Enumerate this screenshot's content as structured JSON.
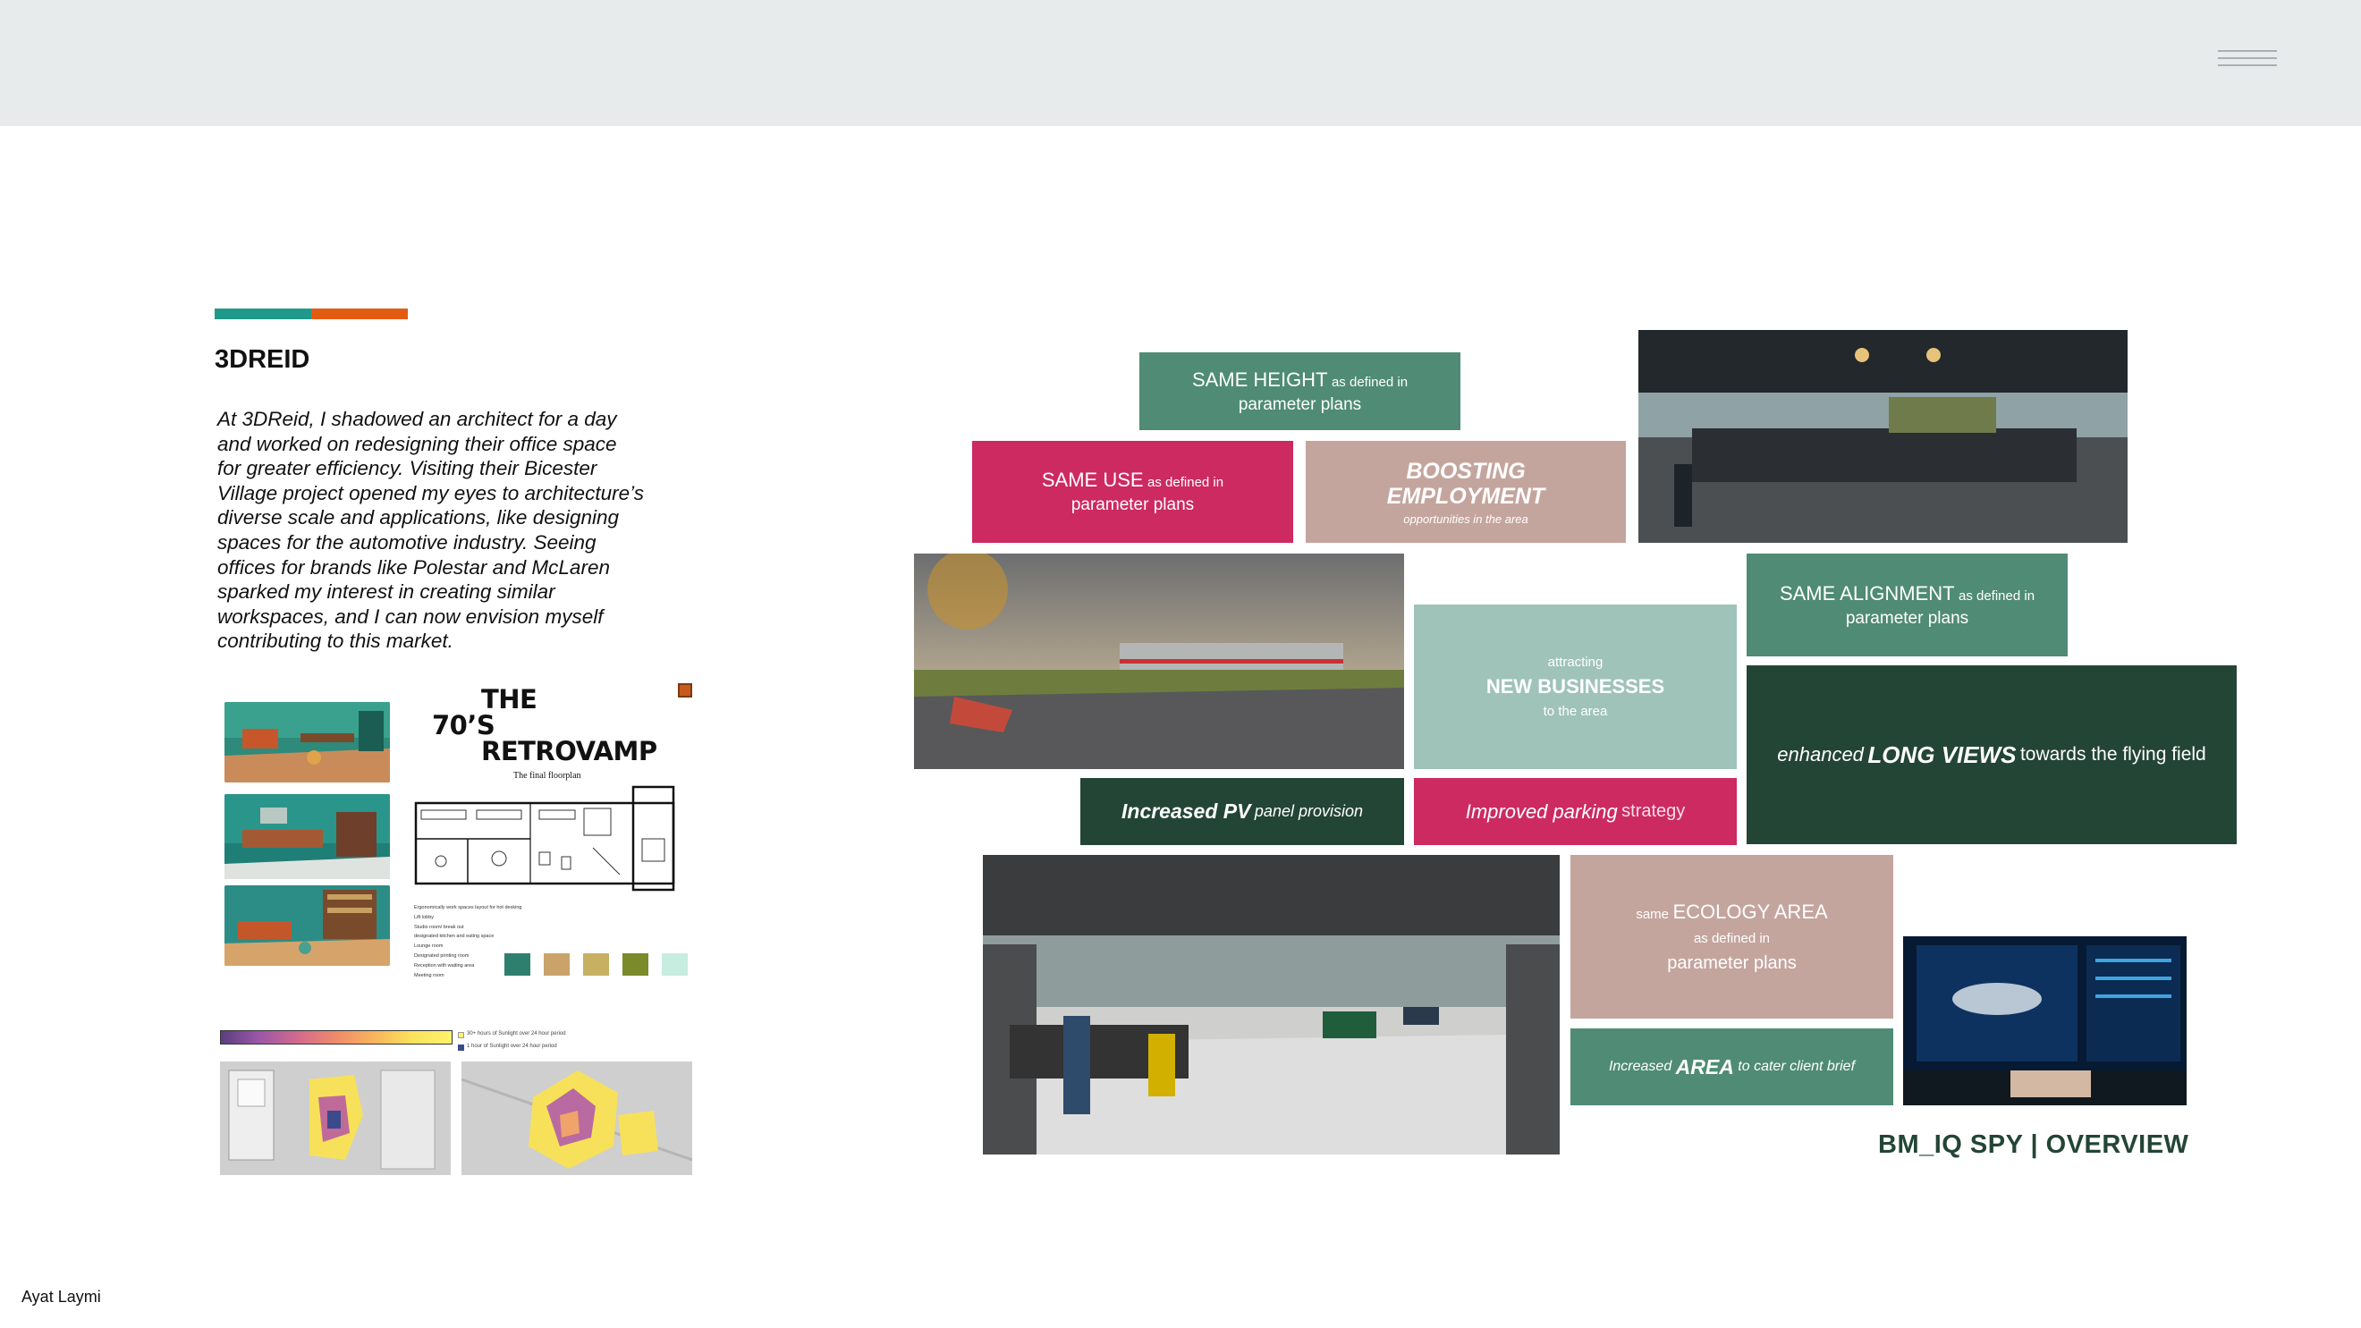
{
  "header": {
    "menu_icon": "hamburger-menu-icon"
  },
  "left": {
    "accent_colors": [
      "#1f9a8a",
      "#e35b12"
    ],
    "title": "3DREID",
    "paragraph_lines": [
      "At 3DReid, I shadowed an architect for a day",
      "and worked on redesigning their office space",
      "for greater efficiency. Visiting their Bicester",
      "Village project opened my eyes to architecture’s",
      "diverse scale and applications, like designing",
      "spaces for the automotive industry. Seeing",
      "offices for brands like Polestar and McLaren",
      "sparked my interest in creating similar",
      "workspaces, and I can now envision myself",
      "contributing to this market."
    ],
    "retrovamp": {
      "title_line1": "THE",
      "title_line2": "70’S",
      "title_line3": "RETROVAMP",
      "subtitle": "The final floorplan",
      "notes": [
        "Ergonomically work spaces layout for hot desking",
        "Lift lobby",
        "Studio room/ break out",
        "designated kitchen and eating space",
        "Lounge room",
        "Designated printing room",
        "Reception with waiting area",
        "Meeting room"
      ],
      "swatch_colors": [
        "#2f7f6f",
        "#c9a36a",
        "#c8b062",
        "#7b8a2a",
        "#c7ece0"
      ]
    },
    "sunlight": {
      "scale_ticks": [
        "0",
        "1",
        "2",
        "3",
        "4",
        "5",
        "6",
        "7",
        "8",
        "9"
      ],
      "legend_1": "30+ hours of Sunlight over 24 hour period",
      "legend_2": "1 hour of Sunlight over 24 hour period"
    }
  },
  "tiles": {
    "same_height": {
      "main": "SAME HEIGHT",
      "suffix": "as defined in",
      "line2": "parameter plans"
    },
    "same_use": {
      "main": "SAME USE",
      "suffix": "as defined in",
      "line2": "parameter plans"
    },
    "boosting": {
      "line1": "BOOSTING",
      "line2": "EMPLOYMENT",
      "line3": "opportunities in the area"
    },
    "new_business": {
      "line1": "attracting",
      "line2": "NEW BUSINESSES",
      "line3": "to the area"
    },
    "same_alignment": {
      "main": "SAME ALIGNMENT",
      "suffix": "as defined in",
      "line2": "parameter plans"
    },
    "long_views": {
      "pre": "enhanced",
      "strong": "LONG VIEWS",
      "post": "towards the flying field"
    },
    "pv": {
      "strong": "Increased PV",
      "post": "panel provision"
    },
    "parking": {
      "strong": "Improved parking",
      "post": "strategy"
    },
    "ecology": {
      "pre": "same",
      "main": "ECOLOGY AREA",
      "line2": "as defined in",
      "line3": "parameter plans"
    },
    "area": {
      "pre": "Increased",
      "strong": "AREA",
      "post": "to cater client brief"
    }
  },
  "overview_title": "BM_IQ SPY | OVERVIEW",
  "author": "Ayat Laymi"
}
